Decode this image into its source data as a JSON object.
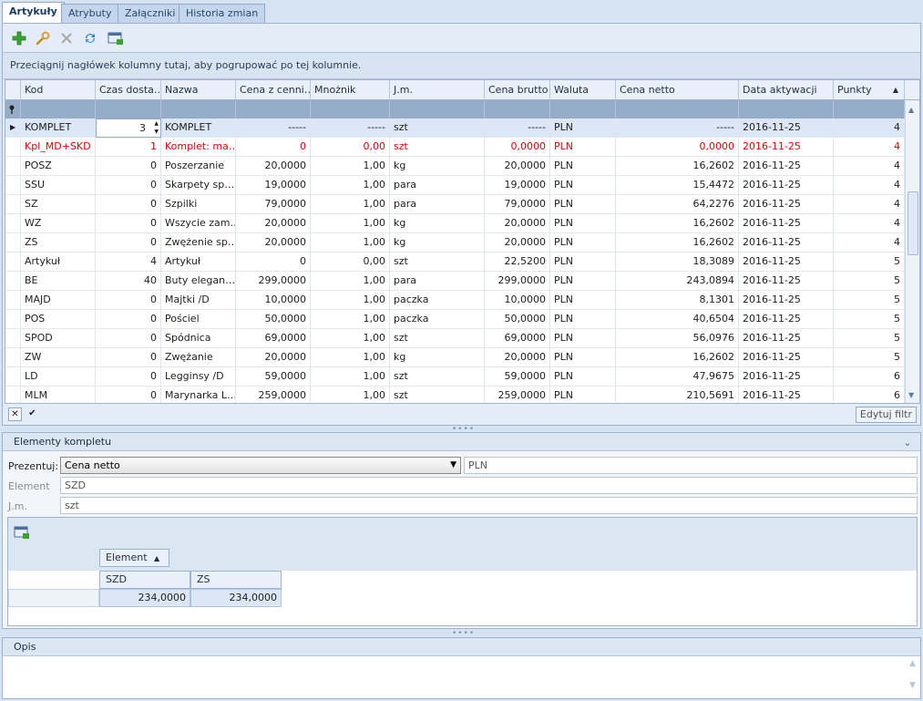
{
  "tabs": [
    "Artykuły",
    "Atrybuty",
    "Załączniki",
    "Historia zmian"
  ],
  "group_hint": "Przeciągnij nagłówek kolumny tutaj, aby pogrupować po tej kolumnie.",
  "columns": [
    "Kod",
    "Czas dosta…",
    "Nazwa",
    "Cena z cenni…",
    "Mnożnik",
    "J.m.",
    "Cena brutto",
    "Waluta",
    "Cena netto",
    "Data aktywacji",
    "Punkty"
  ],
  "rows": [
    {
      "kod": "KOMPLET",
      "czas": "3",
      "nazwa": "KOMPLET",
      "cena_cennik": "-----",
      "mnoznik": "-----",
      "jm": "szt",
      "brutto": "-----",
      "waluta": "PLN",
      "netto": "-----",
      "data": "2016-11-25",
      "punkty": "4"
    },
    {
      "kod": "Kpl_MD+SKD",
      "czas": "1",
      "nazwa": "Komplet: ma…",
      "cena_cennik": "0",
      "mnoznik": "0,00",
      "jm": "szt",
      "brutto": "0,0000",
      "waluta": "PLN",
      "netto": "0,0000",
      "data": "2016-11-25",
      "punkty": "4"
    },
    {
      "kod": "POSZ",
      "czas": "0",
      "nazwa": "Poszerzanie",
      "cena_cennik": "20,0000",
      "mnoznik": "1,00",
      "jm": "kg",
      "brutto": "20,0000",
      "waluta": "PLN",
      "netto": "16,2602",
      "data": "2016-11-25",
      "punkty": "4"
    },
    {
      "kod": "SSU",
      "czas": "0",
      "nazwa": "Skarpety sp…",
      "cena_cennik": "19,0000",
      "mnoznik": "1,00",
      "jm": "para",
      "brutto": "19,0000",
      "waluta": "PLN",
      "netto": "15,4472",
      "data": "2016-11-25",
      "punkty": "4"
    },
    {
      "kod": "SZ",
      "czas": "0",
      "nazwa": "Szpilki",
      "cena_cennik": "79,0000",
      "mnoznik": "1,00",
      "jm": "para",
      "brutto": "79,0000",
      "waluta": "PLN",
      "netto": "64,2276",
      "data": "2016-11-25",
      "punkty": "4"
    },
    {
      "kod": "WZ",
      "czas": "0",
      "nazwa": "Wszycie zam…",
      "cena_cennik": "20,0000",
      "mnoznik": "1,00",
      "jm": "kg",
      "brutto": "20,0000",
      "waluta": "PLN",
      "netto": "16,2602",
      "data": "2016-11-25",
      "punkty": "4"
    },
    {
      "kod": "ZS",
      "czas": "0",
      "nazwa": "Zwężenie sp…",
      "cena_cennik": "20,0000",
      "mnoznik": "1,00",
      "jm": "kg",
      "brutto": "20,0000",
      "waluta": "PLN",
      "netto": "16,2602",
      "data": "2016-11-25",
      "punkty": "4"
    },
    {
      "kod": "Artykuł",
      "czas": "4",
      "nazwa": "Artykuł",
      "cena_cennik": "0",
      "mnoznik": "0,00",
      "jm": "szt",
      "brutto": "22,5200",
      "waluta": "PLN",
      "netto": "18,3089",
      "data": "2016-11-25",
      "punkty": "5"
    },
    {
      "kod": "BE",
      "czas": "40",
      "nazwa": "Buty elegan…",
      "cena_cennik": "299,0000",
      "mnoznik": "1,00",
      "jm": "para",
      "brutto": "299,0000",
      "waluta": "PLN",
      "netto": "243,0894",
      "data": "2016-11-25",
      "punkty": "5"
    },
    {
      "kod": "MAJD",
      "czas": "0",
      "nazwa": "Majtki /D",
      "cena_cennik": "10,0000",
      "mnoznik": "1,00",
      "jm": "paczka",
      "brutto": "10,0000",
      "waluta": "PLN",
      "netto": "8,1301",
      "data": "2016-11-25",
      "punkty": "5"
    },
    {
      "kod": "POS",
      "czas": "0",
      "nazwa": "Pościel",
      "cena_cennik": "50,0000",
      "mnoznik": "1,00",
      "jm": "paczka",
      "brutto": "50,0000",
      "waluta": "PLN",
      "netto": "40,6504",
      "data": "2016-11-25",
      "punkty": "5"
    },
    {
      "kod": "SPOD",
      "czas": "0",
      "nazwa": "Spódnica",
      "cena_cennik": "69,0000",
      "mnoznik": "1,00",
      "jm": "szt",
      "brutto": "69,0000",
      "waluta": "PLN",
      "netto": "56,0976",
      "data": "2016-11-25",
      "punkty": "5"
    },
    {
      "kod": "ZW",
      "czas": "0",
      "nazwa": "Zwężanie",
      "cena_cennik": "20,0000",
      "mnoznik": "1,00",
      "jm": "kg",
      "brutto": "20,0000",
      "waluta": "PLN",
      "netto": "16,2602",
      "data": "2016-11-25",
      "punkty": "5"
    },
    {
      "kod": "LD",
      "czas": "0",
      "nazwa": "Legginsy /D",
      "cena_cennik": "59,0000",
      "mnoznik": "1,00",
      "jm": "szt",
      "brutto": "59,0000",
      "waluta": "PLN",
      "netto": "47,9675",
      "data": "2016-11-25",
      "punkty": "6"
    },
    {
      "kod": "MLM",
      "czas": "0",
      "nazwa": "Marynarka L…",
      "cena_cennik": "259,0000",
      "mnoznik": "1,00",
      "jm": "szt",
      "brutto": "259,0000",
      "waluta": "PLN",
      "netto": "210,5691",
      "data": "2016-11-25",
      "punkty": "6"
    }
  ],
  "grid_footer": {
    "edit_filter": "Edytuj filtr"
  },
  "kit": {
    "title": "Elementy kompletu",
    "prezentuj_label": "Prezentuj:",
    "prezentuj_value": "Cena netto",
    "currency": "PLN",
    "element_label": "Element",
    "element_value": "SZD",
    "jm_label": "J.m.",
    "jm_value": "szt",
    "pivot_header": "Element",
    "pivot_columns": [
      "SZD",
      "ZS"
    ],
    "pivot_values": [
      "234,0000",
      "234,0000"
    ]
  },
  "opis": {
    "title": "Opis"
  },
  "colors": {
    "accent": "#1a3b66",
    "red_row": "#e00000",
    "selected_row": "#dbe7f6"
  }
}
